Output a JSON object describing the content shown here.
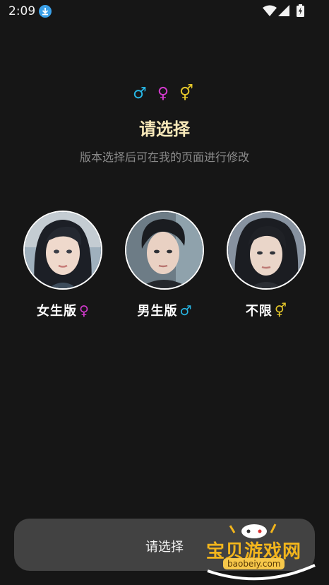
{
  "status_bar": {
    "time": "2:09"
  },
  "header": {
    "symbols": {
      "male": "♂",
      "female": "♀",
      "any": "⚥"
    },
    "title": "请选择",
    "subtitle": "版本选择后可在我的页面进行修改"
  },
  "options": [
    {
      "label": "女生版",
      "gender_symbol": "♀",
      "gender_color": "#d63ad0"
    },
    {
      "label": "男生版",
      "gender_symbol": "♂",
      "gender_color": "#27b6e4"
    },
    {
      "label": "不限",
      "gender_symbol": "⚥",
      "gender_color": "#e6c82a"
    }
  ],
  "bottom_button": {
    "label": "请选择"
  },
  "watermark": {
    "text": "宝贝游戏网",
    "url": "baobeiy.com"
  },
  "colors": {
    "background": "#161616",
    "title": "#f6e7b8",
    "button_bg": "#424242",
    "male": "#27b6e4",
    "female": "#d63ad0",
    "any": "#e6c82a"
  }
}
